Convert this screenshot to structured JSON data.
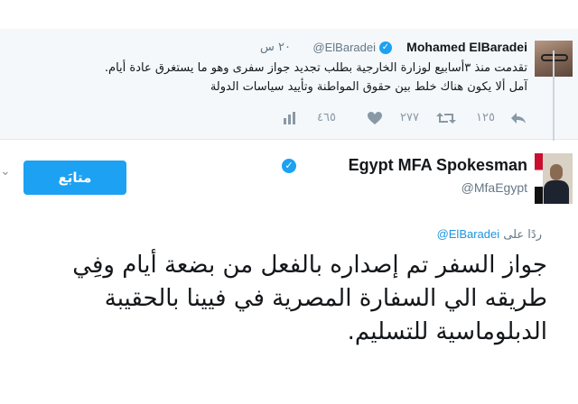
{
  "quoted_tweet": {
    "name": "Mohamed ElBaradei",
    "handle": "@ElBaradei",
    "time": "٢٠ س",
    "text_line1": "تقدمت منذ ٣أسابيع لوزارة الخارجية بطلب تجديد جواز سفرى وهو ما يستغرق عادة أيام.",
    "text_line2": "آمل ألا يكون هناك خلط بين حقوق المواطنة وتأييد سياسات الدولة",
    "retweets": "١٢٥",
    "likes": "٢٧٧",
    "stat_count": "٤٦٥"
  },
  "main_tweet": {
    "name": "Egypt MFA Spokesman",
    "handle": "@MfaEgypt",
    "follow_label": "متابَع",
    "reply_prefix": "ردًا على",
    "reply_handle": "@ElBaradei",
    "text": "جواز السفر تم إصداره بالفعل من بضعة أيام وفِي طريقه الي السفارة المصرية في فيينا بالحقيبة الدبلوماسية للتسليم."
  },
  "icons": {
    "verified": "verified-check-icon",
    "reply": "reply-arrow-icon",
    "retweet": "retweet-icon",
    "like": "heart-icon",
    "stat": "activity-icon",
    "menu": "chevron-down-icon"
  },
  "colors": {
    "accent": "#1da1f2",
    "link": "#1b95e0",
    "muted": "#657786"
  }
}
